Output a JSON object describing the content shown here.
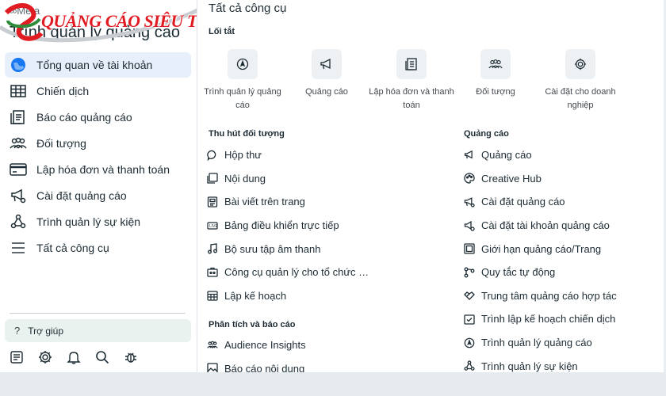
{
  "header": {
    "meta_label": "∞Meta",
    "app_title": "Trình quản lý quảng cáo",
    "watermark": "QUẢNG CÁO SIÊU TỐC"
  },
  "sidebar": {
    "items": [
      {
        "label": "Tổng quan về tài khoản",
        "icon": "globe-icon",
        "active": true
      },
      {
        "label": "Chiến dịch",
        "icon": "table-icon"
      },
      {
        "label": "Báo cáo quảng cáo",
        "icon": "report-icon"
      },
      {
        "label": "Đối tượng",
        "icon": "people-icon"
      },
      {
        "label": "Lập hóa đơn và thanh toán",
        "icon": "credit-card-icon"
      },
      {
        "label": "Cài đặt quảng cáo",
        "icon": "megaphone-settings-icon"
      },
      {
        "label": "Trình quản lý sự kiện",
        "icon": "event-graph-icon"
      },
      {
        "label": "Tất cả công cụ",
        "icon": "menu-icon"
      }
    ],
    "help_label": "Trợ giúp",
    "bottom_icons": [
      "notes-icon",
      "gear-icon",
      "bell-icon",
      "search-icon",
      "bug-icon"
    ]
  },
  "main": {
    "title": "Tất cả công cụ",
    "shortcuts_label": "Lối tắt",
    "shortcuts": [
      {
        "label": "Trình quản lý quảng cáo",
        "icon": "compass-icon"
      },
      {
        "label": "Quảng cáo",
        "icon": "megaphone-icon"
      },
      {
        "label": "Lập hóa đơn và thanh toán",
        "icon": "invoice-icon"
      },
      {
        "label": "Đối tượng",
        "icon": "people-icon"
      },
      {
        "label": "Cài đặt cho doanh nghiệp",
        "icon": "gear-icon"
      }
    ],
    "engage_label": "Thu hút đối tượng",
    "engage_items": [
      {
        "label": "Hộp thư",
        "icon": "chat-icon"
      },
      {
        "label": "Nội dung",
        "icon": "content-icon"
      },
      {
        "label": "Bài viết trên trang",
        "icon": "page-post-icon"
      },
      {
        "label": "Bảng điều khiển trực tiếp",
        "icon": "live-icon"
      },
      {
        "label": "Bộ sưu tập âm thanh",
        "icon": "music-icon"
      },
      {
        "label": "Công cụ quản lý cho tổ chức …",
        "icon": "org-tools-icon"
      },
      {
        "label": "Lập kế hoạch",
        "icon": "calendar-icon"
      }
    ],
    "analyze_label": "Phân tích và báo cáo",
    "analyze_items": [
      {
        "label": "Audience Insights",
        "icon": "people-icon"
      },
      {
        "label": "Báo cáo nội dung",
        "icon": "image-icon"
      }
    ],
    "ads_label": "Quảng cáo",
    "ads_items": [
      {
        "label": "Quảng cáo",
        "icon": "megaphone-icon"
      },
      {
        "label": "Creative Hub",
        "icon": "palette-icon"
      },
      {
        "label": "Cài đặt quảng cáo",
        "icon": "megaphone-settings-icon"
      },
      {
        "label": "Cài đặt tài khoản quảng cáo",
        "icon": "ad-account-settings-icon"
      },
      {
        "label": "Giới hạn quảng cáo/Trang",
        "icon": "limit-icon"
      },
      {
        "label": "Quy tắc tự động",
        "icon": "rules-icon"
      },
      {
        "label": "Trung tâm quảng cáo hợp tác",
        "icon": "handshake-icon"
      },
      {
        "label": "Trình lập kế hoạch chiến dịch",
        "icon": "checklist-icon"
      },
      {
        "label": "Trình quản lý quảng cáo",
        "icon": "compass-icon"
      },
      {
        "label": "Trình quản lý sự kiện",
        "icon": "event-graph-icon"
      }
    ]
  }
}
